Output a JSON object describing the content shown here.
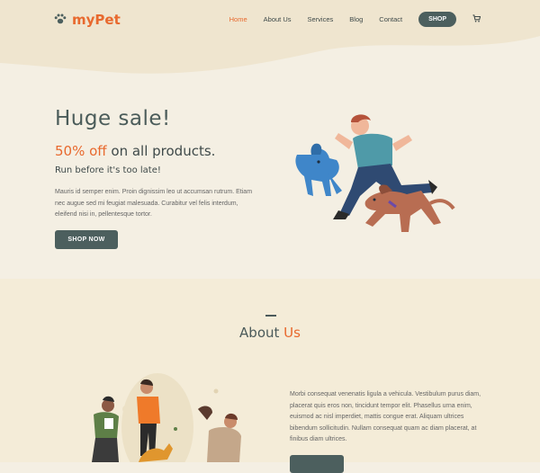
{
  "header": {
    "logo_text": "myPet",
    "nav": [
      "Home",
      "About Us",
      "Services",
      "Blog",
      "Contact"
    ],
    "shop_label": "SHOP"
  },
  "hero": {
    "title": "Huge sale!",
    "offer_accent": "50% off",
    "offer_rest": " on all products.",
    "subtitle": "Run before it's too late!",
    "paragraph": "Mauris id semper enim. Proin dignissim leo ut accumsan rutrum. Etiam nec augue sed mi feugiat malesuada. Curabitur vel felis interdum, eleifend nisi in, pellentesque tortor.",
    "button": "SHOP NOW"
  },
  "about": {
    "title_plain": "About ",
    "title_accent": "Us",
    "paragraph": "Morbi consequat venenatis ligula a vehicula. Vestibulum purus diam, placerat quis eros non, tincidunt tempor elit. Phasellus urna enim, euismod ac nisl imperdiet, mattis congue erat. Aliquam ultrices bibendum sollicitudin. Nullam consequat quam ac diam placerat, at finibus diam ultrices."
  },
  "colors": {
    "accent": "#e8692e",
    "button": "#4c5f5e",
    "hero_bg": "#f4efe3",
    "wave": "#efe5cf",
    "about_bg": "#f4ecd8"
  },
  "icons": [
    "paw-icon",
    "cart-icon"
  ]
}
